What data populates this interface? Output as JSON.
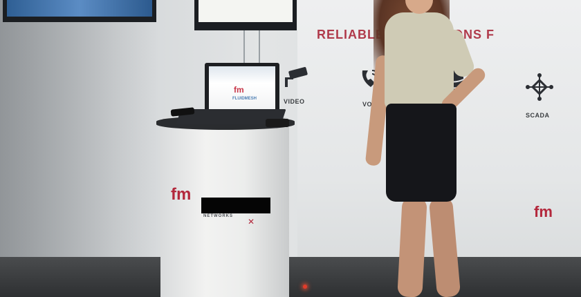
{
  "banner": {
    "text": "RELIABLE  G SOLUTIONS F"
  },
  "icons": [
    {
      "name": "cctv-camera-icon",
      "label": "VIDEO"
    },
    {
      "name": "voip-phone-icon",
      "label": "VOI"
    },
    {
      "name": "database-icon",
      "label": ""
    },
    {
      "name": "scada-network-icon",
      "label": "SCADA"
    }
  ],
  "laptop": {
    "screen_brand": "FLUIDMESH"
  },
  "podium": {
    "caption": "NETWORKS"
  },
  "colors": {
    "brand_red": "#b3283c",
    "banner_text": "#b03a4b"
  }
}
